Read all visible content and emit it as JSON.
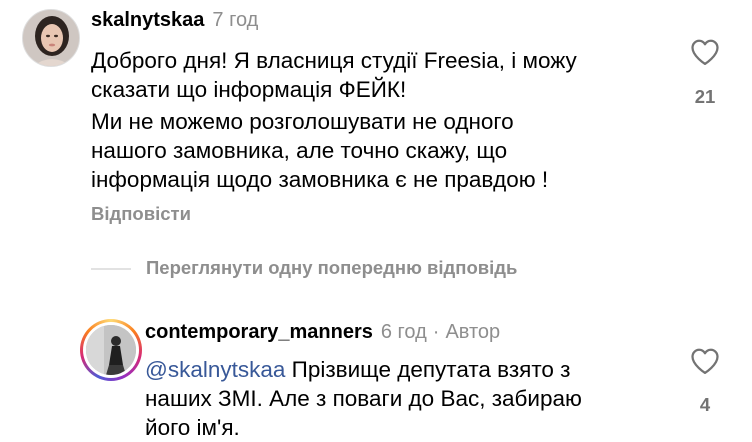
{
  "comments": [
    {
      "username": "skalnytskaa",
      "time": "7 год",
      "paragraph1": "Доброго дня! Я власниця студії Freesia, і можу\nсказати що інформація ФЕЙК!",
      "paragraph2": "Ми не можемо розголошувати не одного\nнашого замовника, але точно скажу, що\nінформація щодо замовника є не правдою !",
      "reply_label": "Відповісти",
      "likes": "21",
      "avatar_icon": "profile-photo"
    }
  ],
  "view_previous_reply": "Переглянути одну попередню відповідь",
  "reply": {
    "username": "contemporary_manners",
    "time": "6 год",
    "separator": "·",
    "author_badge": "Автор",
    "mention": "@skalnytskaa",
    "text_line1": " Прізвище депутата взято з",
    "text_rest": "наших ЗМІ. Але з поваги до Вас, забираю\nйого ім'я.",
    "likes": "4",
    "avatar_icon": "profile-photo",
    "story_ring": true
  },
  "icons": {
    "like": "heart-outline-icon"
  },
  "colors": {
    "text": "#000000",
    "secondary": "#8e8e8e",
    "mention": "#385898",
    "divider": "#e2e2e2"
  }
}
